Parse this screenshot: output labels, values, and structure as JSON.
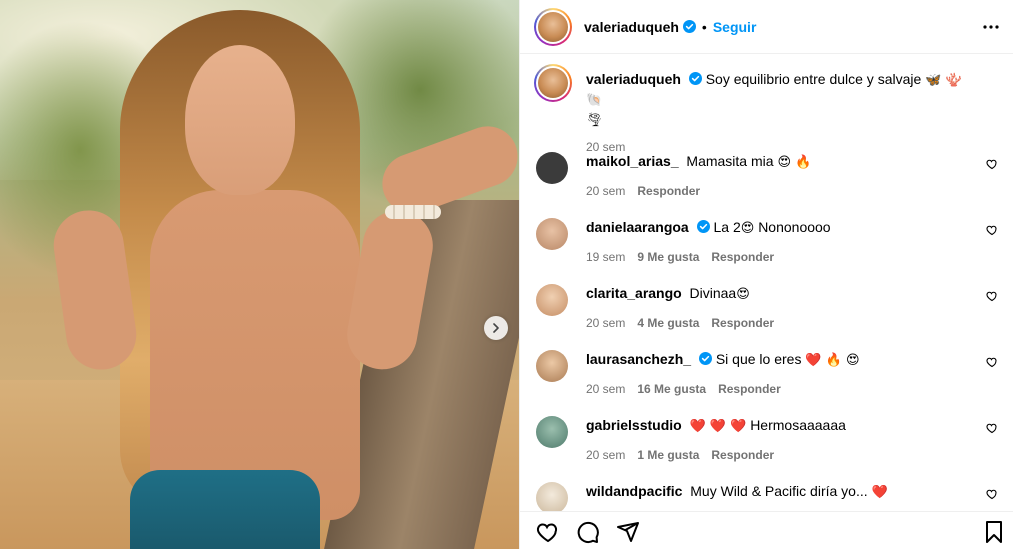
{
  "post": {
    "username": "valeriaduqueh",
    "follow_label": "Seguir",
    "separator": "•",
    "caption_text": "Soy equilibrio entre dulce y salvaje",
    "caption_emojis": "🦋 🪸 🐚",
    "caption_emojis_line2": "🌪",
    "caption_time": "20 sem"
  },
  "comments": [
    {
      "user": "maikol_arias_",
      "verified": false,
      "text": "Mamasita mia",
      "emoji": "😍 🔥",
      "time": "20 sem",
      "likes": "",
      "reply": "Responder",
      "avatar_color": "#3b3b3b"
    },
    {
      "user": "danielaarangoa",
      "verified": true,
      "text": "La 2",
      "emoji": "😍",
      "text2": "Nononoooo",
      "time": "19 sem",
      "likes": "9 Me gusta",
      "reply": "Responder",
      "avatar_color": "#c79a7a"
    },
    {
      "user": "clarita_arango",
      "verified": false,
      "text": "Divinaa",
      "emoji": "😍",
      "time": "20 sem",
      "likes": "4 Me gusta",
      "reply": "Responder",
      "avatar_color": "#d4a17e"
    },
    {
      "user": "laurasanchezh_",
      "verified": true,
      "text": "Si que lo eres",
      "emoji": "❤️ 🔥 😍",
      "time": "20 sem",
      "likes": "16 Me gusta",
      "reply": "Responder",
      "avatar_color": "#c69a6a"
    },
    {
      "user": "gabrielsstudio",
      "verified": false,
      "text": "Hermosaaaaaa",
      "emoji_before": "❤️ ❤️ ❤️",
      "time": "20 sem",
      "likes": "1 Me gusta",
      "reply": "Responder",
      "avatar_color": "#5f8f7f"
    },
    {
      "user": "wildandpacific",
      "verified": false,
      "text": "Muy Wild & Pacific diría yo...",
      "emoji": "❤️",
      "time": "",
      "likes": "",
      "reply": "",
      "avatar_color": "#e7d9c6"
    }
  ],
  "colors": {
    "accent": "#0095f6",
    "meta_gray": "#737373",
    "heart_red": "#ed4956"
  },
  "icons": [
    "verified-badge-icon",
    "more-options-icon",
    "heart-icon",
    "comment-icon",
    "share-icon",
    "bookmark-icon",
    "chevron-right-icon"
  ]
}
